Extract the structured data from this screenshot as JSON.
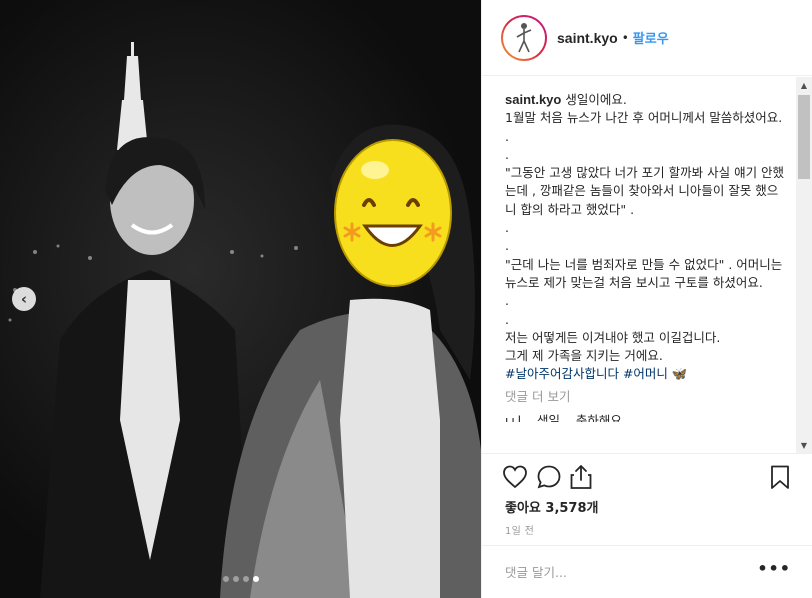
{
  "header": {
    "username": "saint.kyo",
    "separator": "•",
    "follow_label": "팔로우"
  },
  "caption": {
    "username": "saint.kyo",
    "first_line": " 생일이에요.",
    "lines": [
      "1월말 처음 뉴스가 나간 후 어머니께서 말씀하셨어요.",
      ".",
      ".",
      "\"그동안 고생 많았다 너가 포기 할까봐 사실 얘기 안했는데 , 깡패같은 놈들이 찾아와서 니아들이 잘못 했으니 합의 하라고 했었다\" .",
      ".",
      ".",
      "\"근데 나는 너를 범죄자로 만들 수 없었다\" . 어머니는 뉴스로 제가 맞는걸 처음 보시고 구토를 하셨어요.",
      ".",
      ".",
      "저는 어떻게든 이겨내야 했고 이길겁니다.",
      "그게 제 가족을 지키는 거에요."
    ],
    "hashtags": "#날아주어감사합니다 #어머니 🦋",
    "more_comments": "댓글 더 보기",
    "cut_comment": "ʟʟl... 생일... 축하해요"
  },
  "likes": "좋아요 3,578개",
  "time": "1일 전",
  "comment_placeholder": "댓글 달기...",
  "more_options": "•••",
  "carousel": {
    "count": 4,
    "active_index": 3
  },
  "icons": {
    "like": "heart-icon",
    "comment": "comment-icon",
    "share": "share-icon",
    "save": "bookmark-icon",
    "prev": "chevron-left-icon"
  },
  "colors": {
    "follow": "#3897f0",
    "hashtag": "#003569",
    "muted": "#999999"
  }
}
